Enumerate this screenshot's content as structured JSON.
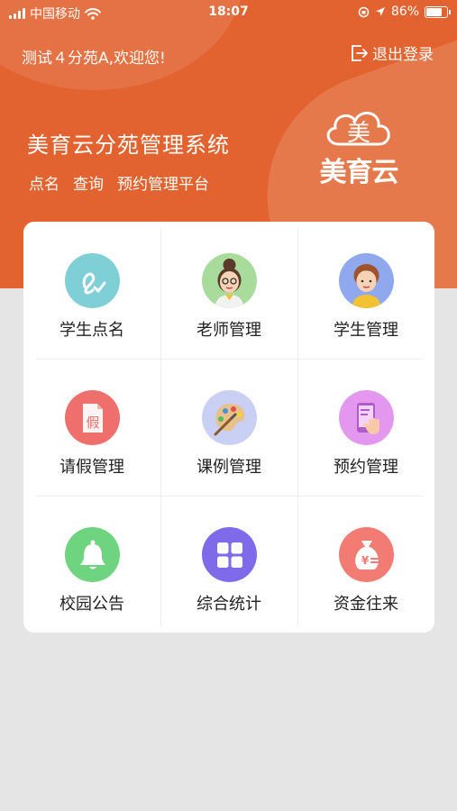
{
  "status_bar": {
    "carrier": "中国移动",
    "time": "18:07",
    "battery": "86%",
    "battery_level": 0.86
  },
  "header": {
    "welcome": "测试４分苑A,欢迎您!",
    "logout_label": "退出登录",
    "title": "美育云分苑管理系统",
    "tags": [
      "点名",
      "查询",
      "预约管理平台"
    ],
    "brand": "美育云",
    "brand_mark": "美"
  },
  "colors": {
    "primary": "#e2632f",
    "background": "#e5e5e5"
  },
  "menu": [
    {
      "label": "学生点名",
      "icon": "signature-icon",
      "color": "#7fcfd6"
    },
    {
      "label": "老师管理",
      "icon": "teacher-avatar-icon",
      "color": "#a9dc9c"
    },
    {
      "label": "学生管理",
      "icon": "student-avatar-icon",
      "color": "#8fa8ee"
    },
    {
      "label": "请假管理",
      "icon": "leave-document-icon",
      "color": "#ef6f6c"
    },
    {
      "label": "课例管理",
      "icon": "palette-icon",
      "color": "#c9d0f3"
    },
    {
      "label": "预约管理",
      "icon": "phone-tap-icon",
      "color": "#e397ef"
    },
    {
      "label": "校园公告",
      "icon": "bell-icon",
      "color": "#6fd47f"
    },
    {
      "label": "综合统计",
      "icon": "grid-stats-icon",
      "color": "#7f6bea"
    },
    {
      "label": "资金往来",
      "icon": "money-bag-icon",
      "color": "#f27c74"
    }
  ]
}
